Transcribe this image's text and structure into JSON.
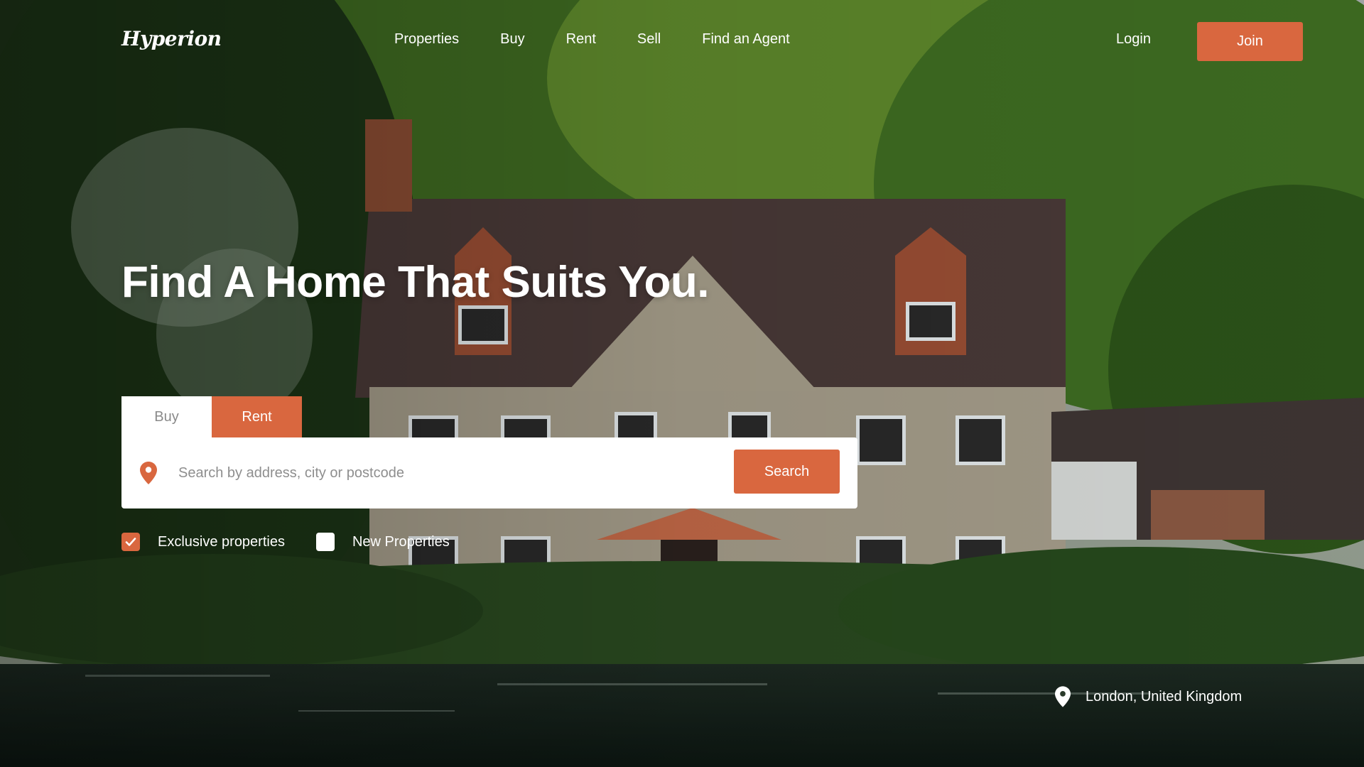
{
  "brand": {
    "logo_text": "Hyperion"
  },
  "nav": {
    "links": [
      "Properties",
      "Buy",
      "Rent",
      "Sell",
      "Find an Agent"
    ],
    "login_label": "Login",
    "join_label": "Join"
  },
  "hero": {
    "headline": "Find A Home That Suits You."
  },
  "search": {
    "tabs": [
      "Buy",
      "Rent"
    ],
    "active_tab": "Rent",
    "placeholder": "Search by address, city or postcode",
    "value": "",
    "button_label": "Search"
  },
  "filters": [
    {
      "label": "Exclusive properties",
      "checked": true
    },
    {
      "label": "New Properties",
      "checked": false
    }
  ],
  "location": {
    "text": "London, United Kingdom"
  },
  "colors": {
    "accent": "#d9673f",
    "white": "#ffffff",
    "placeholder": "#8e8e8e"
  },
  "icons": {
    "search_pin": "map-pin-icon",
    "location_pin": "location-pin-icon",
    "check": "check-icon"
  }
}
